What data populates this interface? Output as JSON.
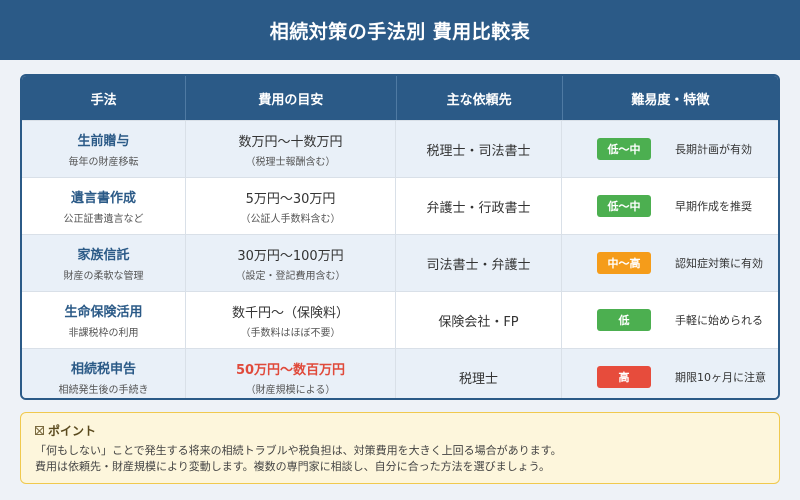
{
  "header": {
    "title": "相続対策の手法別 費用比較表"
  },
  "table": {
    "columns": [
      "手法",
      "費用の目安",
      "主な依頼先",
      "難易度・特徴"
    ],
    "rows": [
      {
        "method": "生前贈与",
        "method_sub": "毎年の財産移転",
        "cost": "数万円〜十数万円",
        "cost_sub": "（税理士報酬含む）",
        "cost_color": "#333333",
        "provider": "税理士・司法書士",
        "difficulty": "低〜中",
        "difficulty_color": "#4caf50",
        "feature": "長期計画が有効"
      },
      {
        "method": "遺言書作成",
        "method_sub": "公正証書遺言など",
        "cost": "5万円〜30万円",
        "cost_sub": "（公証人手数料含む）",
        "cost_color": "#333333",
        "provider": "弁護士・行政書士",
        "difficulty": "低〜中",
        "difficulty_color": "#4caf50",
        "feature": "早期作成を推奨"
      },
      {
        "method": "家族信託",
        "method_sub": "財産の柔軟な管理",
        "cost": "30万円〜100万円",
        "cost_sub": "（設定・登記費用含む）",
        "cost_color": "#333333",
        "provider": "司法書士・弁護士",
        "difficulty": "中〜高",
        "difficulty_color": "#f59c1a",
        "feature": "認知症対策に有効"
      },
      {
        "method": "生命保険活用",
        "method_sub": "非課税枠の利用",
        "cost": "数千円〜（保険料）",
        "cost_sub": "（手数料はほぼ不要）",
        "cost_color": "#333333",
        "provider": "保険会社・FP",
        "difficulty": "低",
        "difficulty_color": "#4caf50",
        "feature": "手軽に始められる"
      },
      {
        "method": "相続税申告",
        "method_sub": "相続発生後の手続き",
        "cost": "50万円〜数百万円",
        "cost_sub": "（財産規模による）",
        "cost_color": "#e04a3b",
        "provider": "税理士",
        "difficulty": "高",
        "difficulty_color": "#e74c3c",
        "feature": "期限10ヶ月に注意"
      }
    ]
  },
  "note": {
    "icon": "pin-icon",
    "title": "ポイント",
    "lines": [
      "「何もしない」ことで発生する将来の相続トラブルや税負担は、対策費用を大きく上回る場合があります。",
      "費用は依頼先・財産規模により変動します。複数の専門家に相談し、自分に合った方法を選びましょう。"
    ]
  }
}
